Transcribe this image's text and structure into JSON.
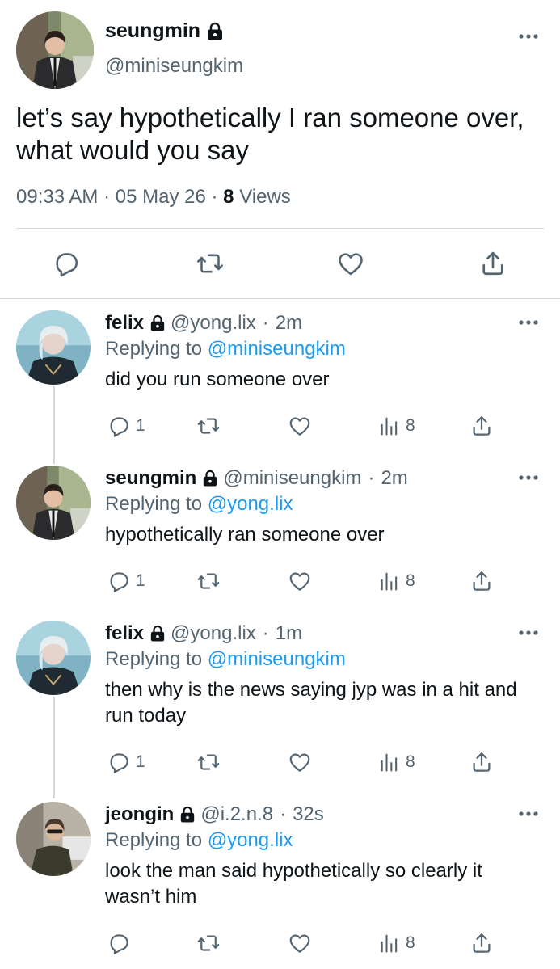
{
  "main_tweet": {
    "display_name": "seungmin",
    "handle": "@miniseungkim",
    "text": "let’s say hypothetically I ran someone over, what would you say",
    "time": "09:33 AM",
    "sep1": "·",
    "date": "05 May 26",
    "sep2": "·",
    "views_count": "8",
    "views_label": "Views",
    "actions": [
      "reply-icon",
      "retweet-icon",
      "like-icon",
      "share-icon"
    ]
  },
  "replies": [
    {
      "display_name": "felix",
      "handle": "@yong.lix",
      "sep": "·",
      "time": "2m",
      "replying_prefix": "Replying to",
      "replying_to": "@miniseungkim",
      "text": "did you run someone over",
      "reply_count": "1",
      "view_count": "8"
    },
    {
      "display_name": "seungmin",
      "handle": "@miniseungkim",
      "sep": "·",
      "time": "2m",
      "replying_prefix": "Replying to",
      "replying_to": "@yong.lix",
      "text": "hypothetically ran someone over",
      "reply_count": "1",
      "view_count": "8"
    },
    {
      "display_name": "felix",
      "handle": "@yong.lix",
      "sep": "·",
      "time": "1m",
      "replying_prefix": "Replying to",
      "replying_to": "@miniseungkim",
      "text": "then why is the news saying jyp was in a hit and run today",
      "reply_count": "1",
      "view_count": "8"
    },
    {
      "display_name": "jeongin",
      "handle": "@i.2.n.8",
      "sep": "·",
      "time": "32s",
      "replying_prefix": "Replying to",
      "replying_to": "@yong.lix",
      "text": "look the man said hypothetically so clearly it wasn’t him",
      "reply_count": "",
      "view_count": "8"
    }
  ],
  "colors": {
    "text": "#0f1419",
    "secondary": "#536471",
    "link": "#1d9bf0",
    "divider": "#cfd9de"
  }
}
